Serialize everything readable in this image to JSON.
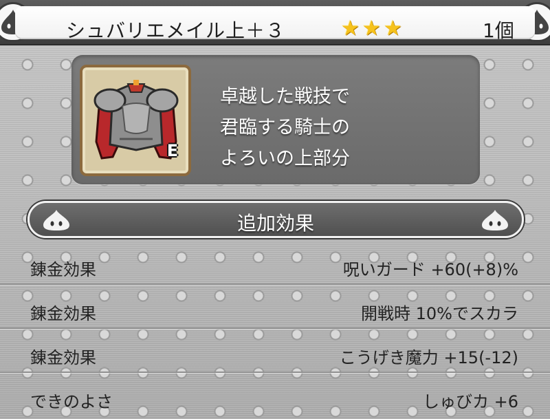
{
  "header": {
    "item_name": "シュバリエメイル上＋３",
    "stars": [
      "★",
      "★",
      "★"
    ],
    "quantity": "1個"
  },
  "item": {
    "icon": "chest-armor-icon",
    "equip_badge": "E",
    "description": [
      "卓越した戦技で",
      "君臨する騎士の",
      "よろいの上部分"
    ]
  },
  "section": {
    "title": "追加効果"
  },
  "effects": [
    {
      "label": "錬金効果",
      "value": "呪いガード +60(+8)%"
    },
    {
      "label": "錬金効果",
      "value": "開戦時 10%でスカラ"
    },
    {
      "label": "錬金効果",
      "value": "こうげき魔力 +15(-12)"
    },
    {
      "label": "できのよさ",
      "value": "しゅびカ +6"
    }
  ],
  "colors": {
    "star": "#f6c21c",
    "panel": "#6e6e6e",
    "header_bg": "#ffffff",
    "text_dark": "#222222"
  }
}
